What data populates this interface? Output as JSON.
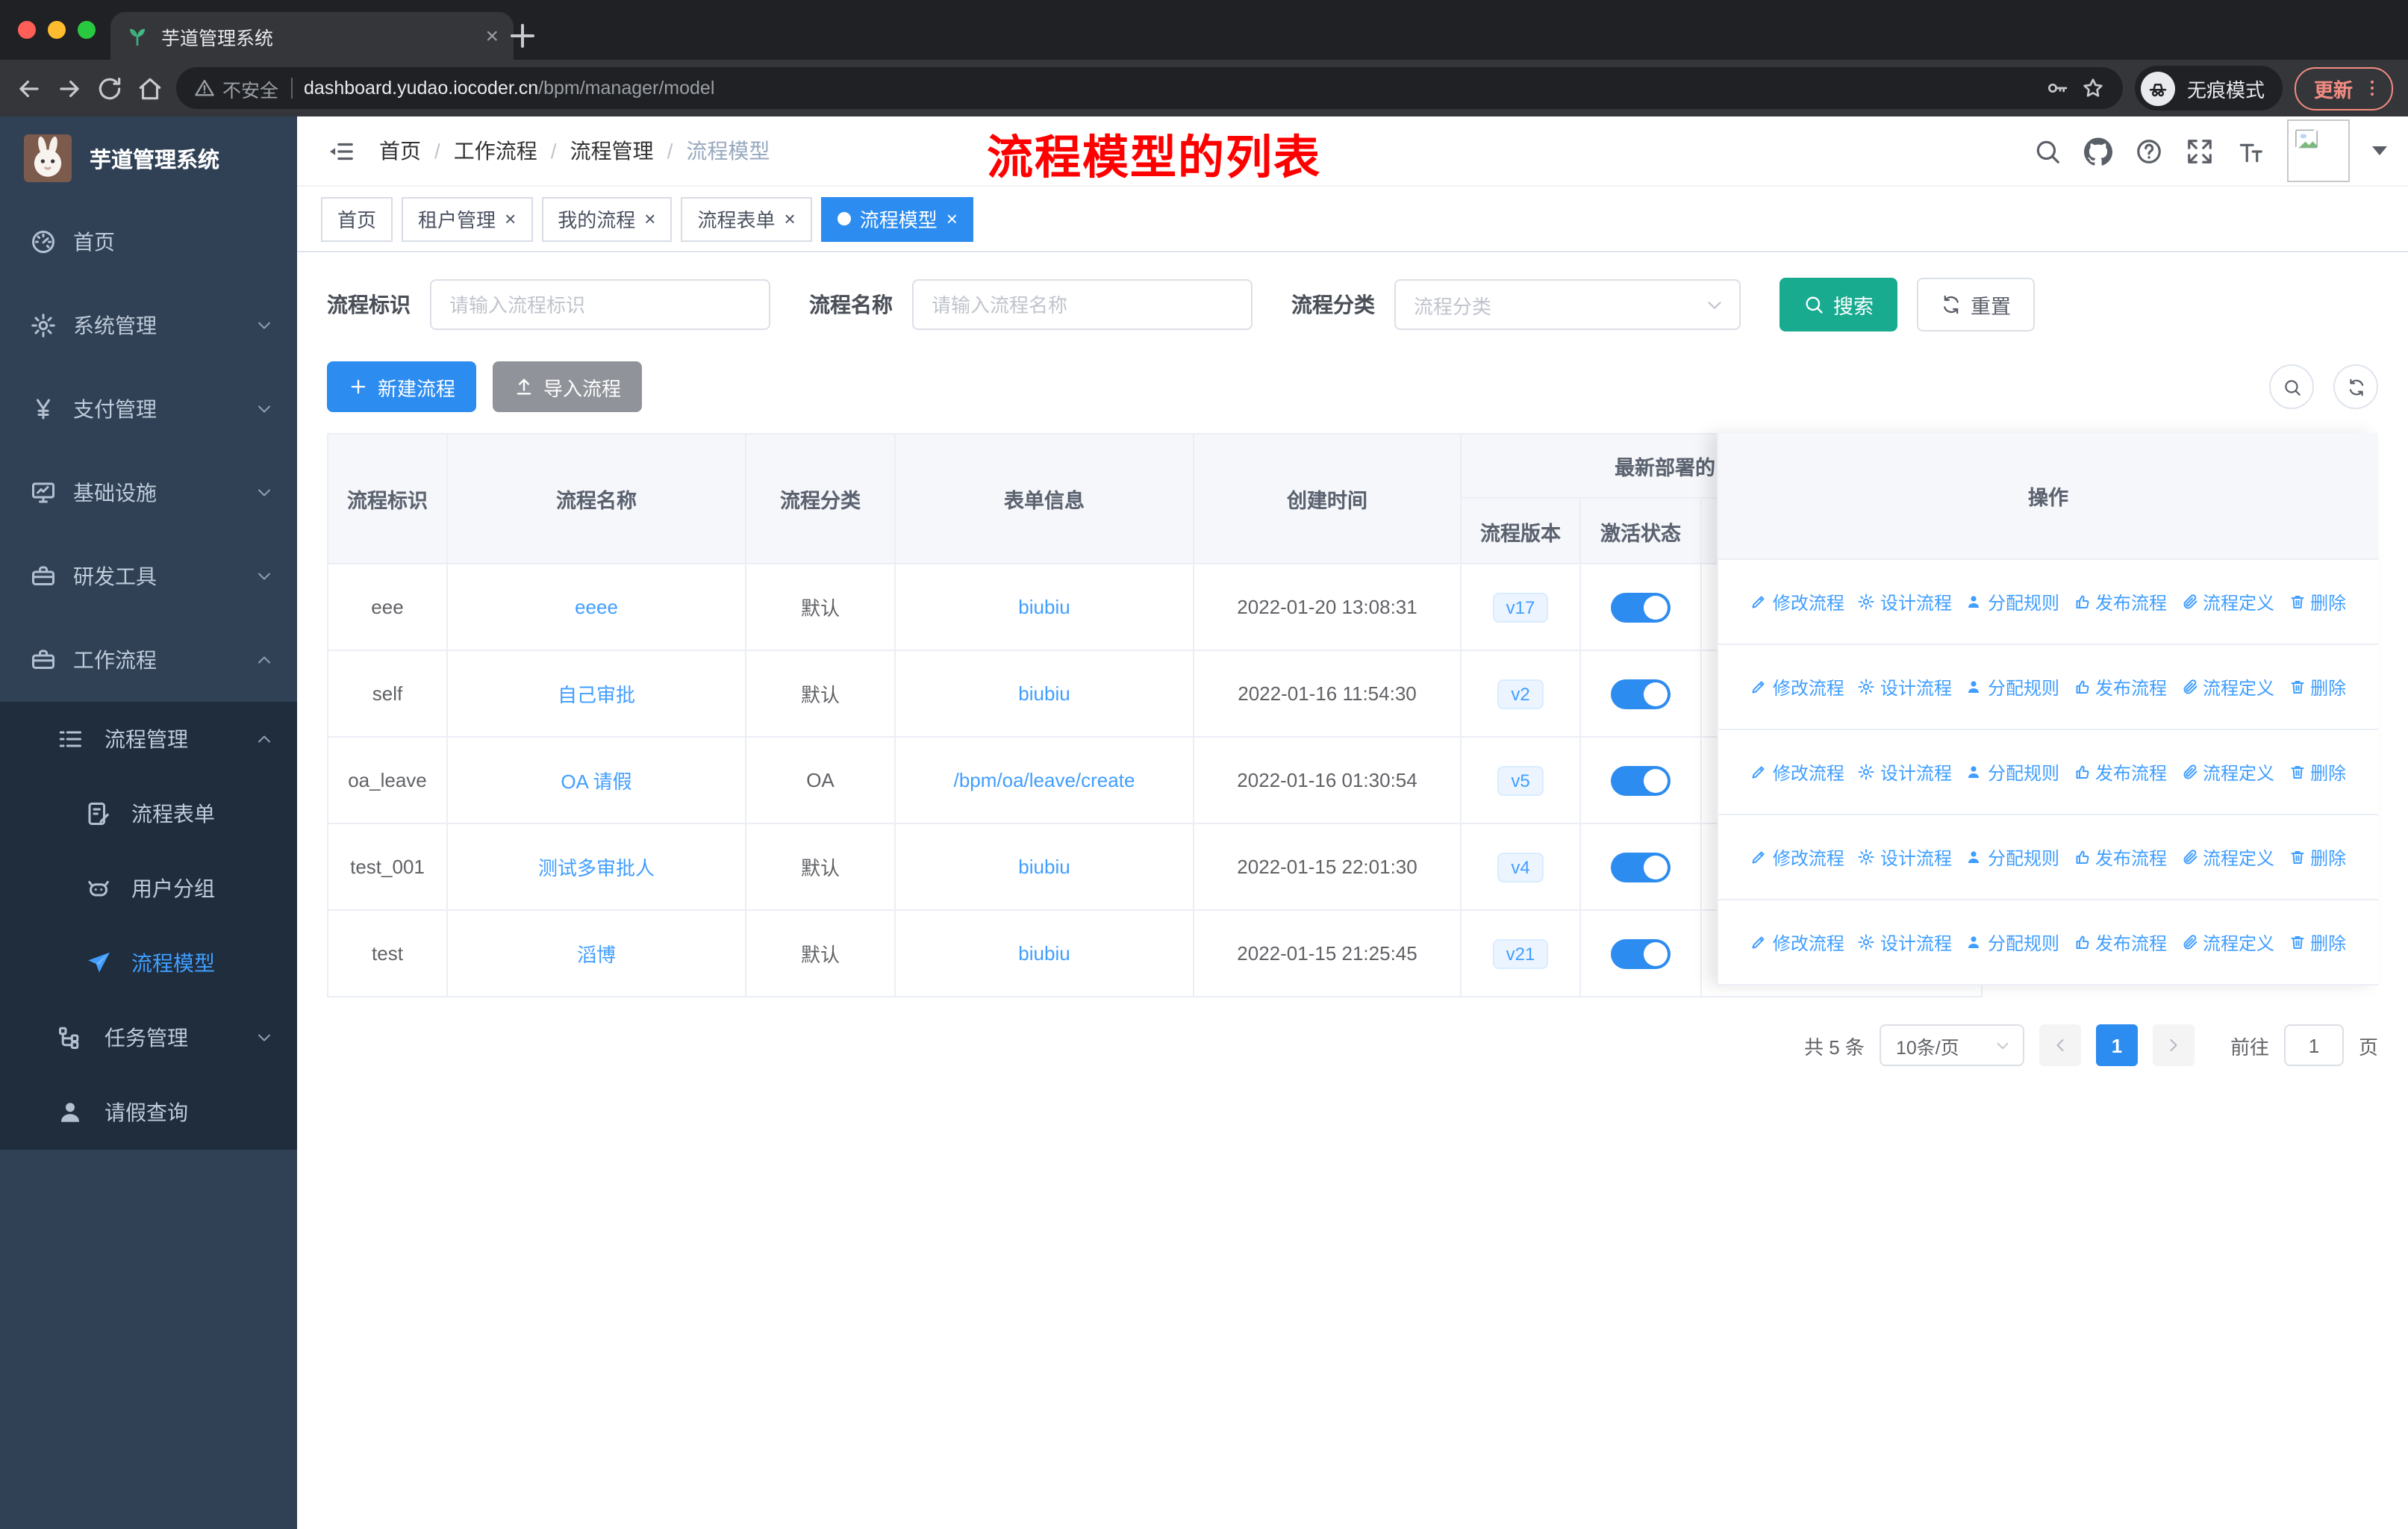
{
  "browser": {
    "tab_title": "芋道管理系统",
    "security_label": "不安全",
    "url_host": "dashboard.yudao.iocoder.cn",
    "url_path": "/bpm/manager/model",
    "incognito_label": "无痕模式",
    "update_label": "更新"
  },
  "sidebar": {
    "app_title": "芋道管理系统",
    "menu": [
      {
        "label": "首页",
        "icon": "dashboard-icon",
        "level": 1
      },
      {
        "label": "系统管理",
        "icon": "gear-icon",
        "level": 1,
        "chevron": "down"
      },
      {
        "label": "支付管理",
        "icon": "yen-icon",
        "level": 1,
        "chevron": "down"
      },
      {
        "label": "基础设施",
        "icon": "monitor-icon",
        "level": 1,
        "chevron": "down"
      },
      {
        "label": "研发工具",
        "icon": "toolbox-icon",
        "level": 1,
        "chevron": "down"
      },
      {
        "label": "工作流程",
        "icon": "briefcase-icon",
        "level": 1,
        "chevron": "up"
      },
      {
        "label": "流程管理",
        "icon": "list-icon",
        "level": 2,
        "chevron": "up"
      },
      {
        "label": "流程表单",
        "icon": "form-icon",
        "level": 3
      },
      {
        "label": "用户分组",
        "icon": "robot-icon",
        "level": 3
      },
      {
        "label": "流程模型",
        "icon": "paper-plane-icon",
        "level": 3,
        "active": true
      },
      {
        "label": "任务管理",
        "icon": "tree-icon",
        "level": 2,
        "chevron": "down"
      },
      {
        "label": "请假查询",
        "icon": "user-icon",
        "level": 2
      }
    ]
  },
  "header": {
    "breadcrumb": [
      "首页",
      "工作流程",
      "流程管理",
      "流程模型"
    ],
    "annotation": "流程模型的列表",
    "icons": [
      "search-icon",
      "github-icon",
      "help-icon",
      "fullscreen-icon",
      "font-size-icon"
    ]
  },
  "tags": [
    {
      "label": "首页",
      "closable": false,
      "active": false
    },
    {
      "label": "租户管理",
      "closable": true,
      "active": false
    },
    {
      "label": "我的流程",
      "closable": true,
      "active": false
    },
    {
      "label": "流程表单",
      "closable": true,
      "active": false
    },
    {
      "label": "流程模型",
      "closable": true,
      "active": true
    }
  ],
  "filters": {
    "id_label": "流程标识",
    "id_placeholder": "请输入流程标识",
    "name_label": "流程名称",
    "name_placeholder": "请输入流程名称",
    "category_label": "流程分类",
    "category_placeholder": "流程分类",
    "search_label": "搜索",
    "reset_label": "重置"
  },
  "toolbar": {
    "create_label": "新建流程",
    "import_label": "导入流程"
  },
  "table": {
    "headers": {
      "id": "流程标识",
      "name": "流程名称",
      "category": "流程分类",
      "form": "表单信息",
      "created": "创建时间",
      "deploy_group": "最新部署的",
      "version": "流程版本",
      "active": "激活状态",
      "ops": "操作"
    },
    "rows": [
      {
        "id": "eee",
        "name": "eeee",
        "category": "默认",
        "form": "biubiu",
        "created": "2022-01-20 13:08:31",
        "version": "v17",
        "active": true
      },
      {
        "id": "self",
        "name": "自己审批",
        "category": "默认",
        "form": "biubiu",
        "created": "2022-01-16 11:54:30",
        "version": "v2",
        "active": true
      },
      {
        "id": "oa_leave",
        "name": "OA 请假",
        "category": "OA",
        "form": "/bpm/oa/leave/create",
        "created": "2022-01-16 01:30:54",
        "version": "v5",
        "active": true
      },
      {
        "id": "test_001",
        "name": "测试多审批人",
        "category": "默认",
        "form": "biubiu",
        "created": "2022-01-15 22:01:30",
        "version": "v4",
        "active": true
      },
      {
        "id": "test",
        "name": "滔博",
        "category": "默认",
        "form": "biubiu",
        "created": "2022-01-15 21:25:45",
        "version": "v21",
        "active": true
      }
    ],
    "actions": [
      {
        "label": "修改流程",
        "icon": "edit-icon"
      },
      {
        "label": "设计流程",
        "icon": "design-gear-icon"
      },
      {
        "label": "分配规则",
        "icon": "assign-user-icon"
      },
      {
        "label": "发布流程",
        "icon": "publish-icon"
      },
      {
        "label": "流程定义",
        "icon": "definition-icon"
      },
      {
        "label": "删除",
        "icon": "delete-icon"
      }
    ]
  },
  "pagination": {
    "total": "共 5 条",
    "page_size": "10条/页",
    "page": "1",
    "goto_label": "前往",
    "goto_value": "1",
    "unit": "页"
  },
  "colors": {
    "primary_link": "#409eff",
    "primary_button": "#2d8cf0",
    "search_teal": "#18ab90",
    "sidebar_bg": "#304156",
    "submenu_bg": "#1f2d3d",
    "annotation_red": "#ff0000",
    "tag_active": "#2d8cf0"
  }
}
